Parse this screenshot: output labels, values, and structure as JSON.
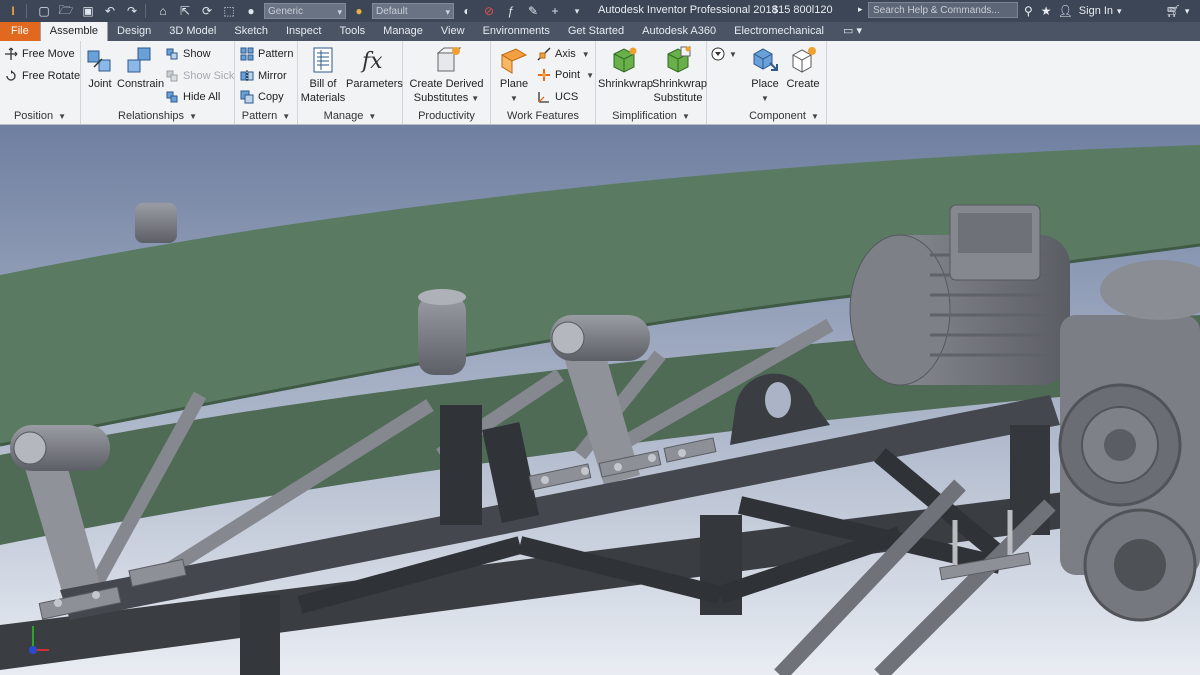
{
  "titlebar": {
    "material_combo": "Generic",
    "appearance_combo": "Default",
    "app_title": "Autodesk Inventor Professional 2018",
    "serial": "$15 800l120",
    "search_placeholder": "Search Help & Commands...",
    "sign_in": "Sign In"
  },
  "tabs": [
    {
      "label": "File"
    },
    {
      "label": "Assemble"
    },
    {
      "label": "Design"
    },
    {
      "label": "3D Model"
    },
    {
      "label": "Sketch"
    },
    {
      "label": "Inspect"
    },
    {
      "label": "Tools"
    },
    {
      "label": "Manage"
    },
    {
      "label": "View"
    },
    {
      "label": "Environments"
    },
    {
      "label": "Get Started"
    },
    {
      "label": "Autodesk A360"
    },
    {
      "label": "Electromechanical"
    }
  ],
  "ribbon": {
    "position": {
      "title": "Position",
      "free_move": "Free Move",
      "free_rotate": "Free Rotate"
    },
    "relationships": {
      "title": "Relationships",
      "joint": "Joint",
      "constrain": "Constrain",
      "show": "Show",
      "show_sick": "Show Sick",
      "hide_all": "Hide All"
    },
    "pattern": {
      "title": "Pattern",
      "pattern": "Pattern",
      "mirror": "Mirror",
      "copy": "Copy"
    },
    "manage": {
      "title": "Manage",
      "bom_line1": "Bill of",
      "bom_line2": "Materials",
      "parameters": "Parameters"
    },
    "productivity": {
      "title": "Productivity",
      "cds_line1": "Create Derived",
      "cds_line2": "Substitutes"
    },
    "work_features": {
      "title": "Work Features",
      "plane": "Plane",
      "axis": "Axis",
      "point": "Point",
      "ucs": "UCS"
    },
    "simplification": {
      "title": "Simplification",
      "shrinkwrap": "Shrinkwrap",
      "sws_line1": "Shrinkwrap",
      "sws_line2": "Substitute"
    },
    "component": {
      "title": "Component",
      "place": "Place",
      "create": "Create"
    }
  },
  "colors": {
    "belt": "#5a7a62",
    "frame": "#3a3d42",
    "background_top": "#6f7fa0",
    "background_bottom": "#e9edf3",
    "file_tab": "#e0681f"
  }
}
